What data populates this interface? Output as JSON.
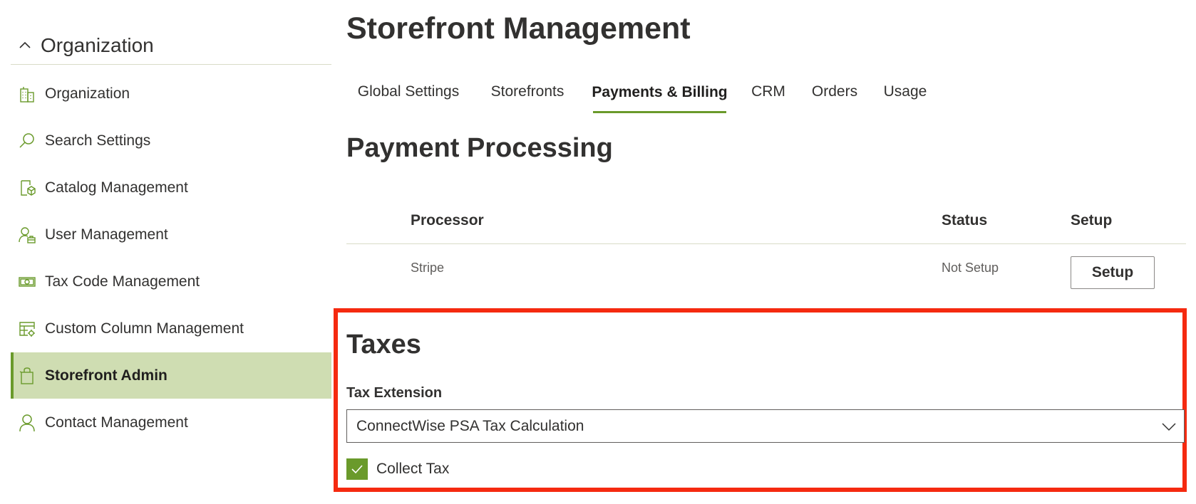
{
  "sidebar": {
    "group_title": "Organization",
    "items": [
      {
        "label": "Organization",
        "icon": "building-icon"
      },
      {
        "label": "Search Settings",
        "icon": "search-icon"
      },
      {
        "label": "Catalog Management",
        "icon": "catalog-icon"
      },
      {
        "label": "User Management",
        "icon": "user-management-icon"
      },
      {
        "label": "Tax Code Management",
        "icon": "money-icon"
      },
      {
        "label": "Custom Column Management",
        "icon": "table-settings-icon"
      },
      {
        "label": "Storefront Admin",
        "icon": "shopping-bag-icon",
        "active": true
      },
      {
        "label": "Contact Management",
        "icon": "contact-icon"
      }
    ]
  },
  "header": {
    "title": "Storefront Management"
  },
  "tabs": [
    {
      "label": "Global Settings"
    },
    {
      "label": "Storefronts"
    },
    {
      "label": "Payments & Billing",
      "active": true
    },
    {
      "label": "CRM"
    },
    {
      "label": "Orders"
    },
    {
      "label": "Usage"
    }
  ],
  "payment": {
    "title": "Payment Processing",
    "columns": [
      "Processor",
      "Status",
      "Setup"
    ],
    "rows": [
      {
        "processor": "Stripe",
        "status": "Not Setup",
        "action": "Setup"
      }
    ]
  },
  "taxes": {
    "title": "Taxes",
    "extension_label": "Tax Extension",
    "extension_value": "ConnectWise PSA Tax Calculation",
    "collect_tax_label": "Collect Tax",
    "collect_tax_checked": true
  },
  "colors": {
    "accent": "#6a9a2b",
    "active_bg": "#cfddb2",
    "highlight": "#f52a10"
  }
}
